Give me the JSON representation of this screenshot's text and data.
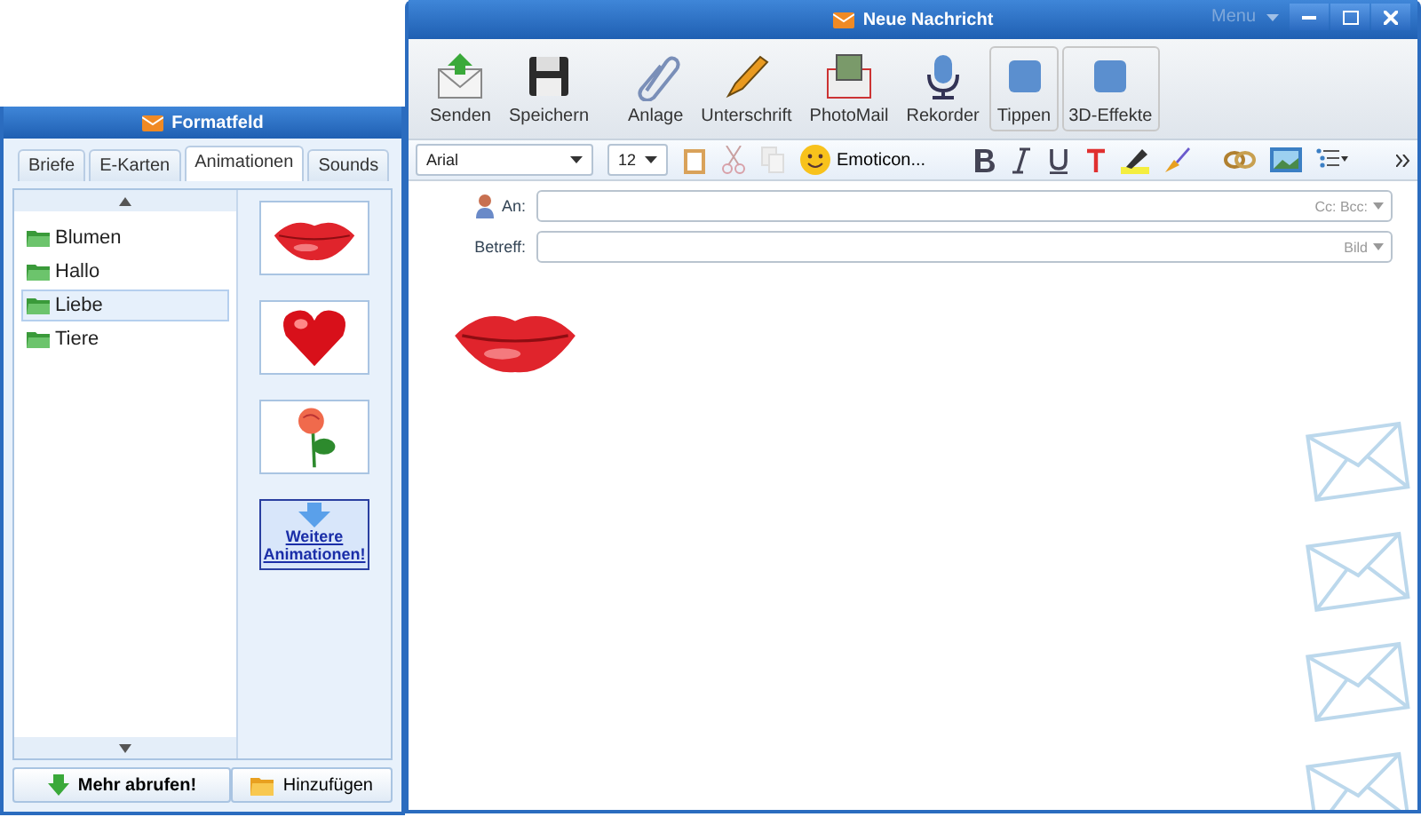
{
  "left_window": {
    "title": "Formatfeld",
    "tabs": [
      {
        "label": "Briefe",
        "selected": false
      },
      {
        "label": "E-Karten",
        "selected": false
      },
      {
        "label": "Animationen",
        "selected": true
      },
      {
        "label": "Sounds",
        "selected": false
      }
    ],
    "categories": [
      {
        "label": "Blumen",
        "selected": false
      },
      {
        "label": "Hallo",
        "selected": false
      },
      {
        "label": "Liebe",
        "selected": true
      },
      {
        "label": "Tiere",
        "selected": false
      }
    ],
    "animations": [
      {
        "kind": "lips"
      },
      {
        "kind": "heart"
      },
      {
        "kind": "rose"
      }
    ],
    "more_link": "Weitere Animationen!",
    "buttons": [
      {
        "label": "Mehr abrufen!",
        "kind": "download"
      },
      {
        "label": "Hinzufügen",
        "kind": "folder"
      }
    ]
  },
  "right_window": {
    "title": "Neue Nachricht",
    "menu": "Menu",
    "toolbar": [
      {
        "label": "Senden",
        "kind": "send"
      },
      {
        "label": "Speichern",
        "kind": "save"
      },
      {
        "label": "Anlage",
        "kind": "clip"
      },
      {
        "label": "Unterschrift",
        "kind": "pen"
      },
      {
        "label": "PhotoMail",
        "kind": "photo"
      },
      {
        "label": "Rekorder",
        "kind": "mic"
      },
      {
        "label": "Tippen",
        "kind": "framed"
      },
      {
        "label": "3D-Effekte",
        "kind": "framed"
      }
    ],
    "font": "Arial",
    "size": "12",
    "emoticons": "Emoticon...",
    "fields": [
      {
        "label": "An:",
        "hint": "Cc: Bcc:",
        "kind": "contact"
      },
      {
        "label": "Betreff:",
        "hint": "Bild",
        "kind": "plain"
      }
    ],
    "body_animation": {
      "kind": "lips"
    }
  }
}
